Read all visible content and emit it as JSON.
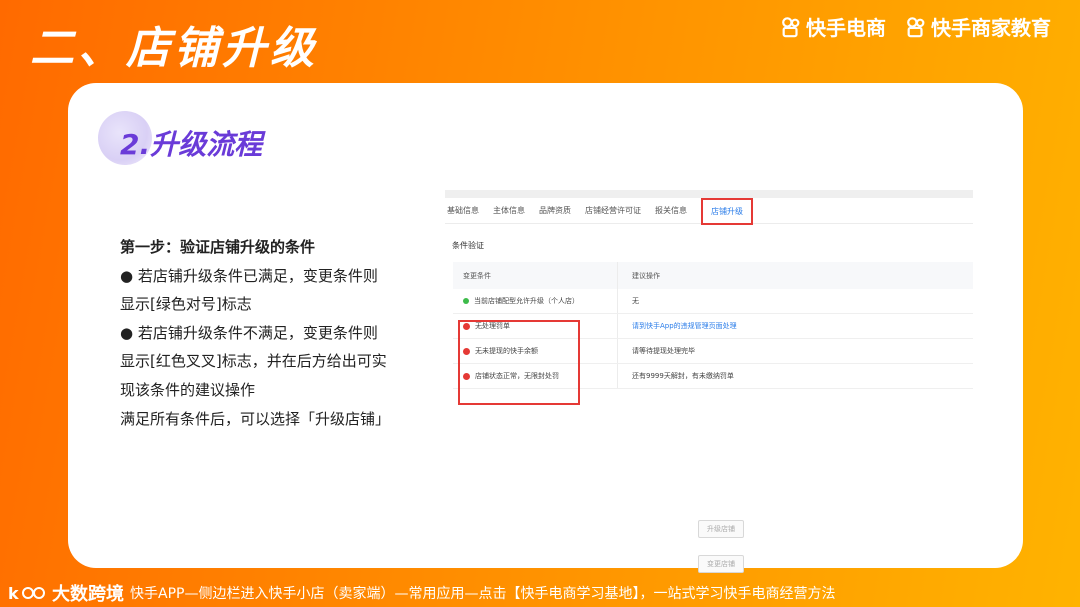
{
  "header": {
    "title": "二、店铺升级",
    "brand1": "快手电商",
    "brand2": "快手商家教育"
  },
  "section": {
    "subtitle": "2.升级流程"
  },
  "steps": {
    "lines": [
      "第一步：验证店铺升级的条件",
      "● 若店铺升级条件已满足，变更条件则",
      "显示[绿色对号]标志",
      "● 若店铺升级条件不满足，变更条件则",
      "显示[红色叉叉]标志，并在后方给出可实",
      "现该条件的建议操作",
      "满足所有条件后，可以选择「升级店铺」"
    ]
  },
  "screenshot": {
    "tabs": [
      "基础信息",
      "主体信息",
      "品牌资质",
      "店铺经营许可证",
      "报关信息",
      "店铺升级"
    ],
    "active_tab_index": 5,
    "section_title": "条件验证",
    "table_headers": [
      "变更条件",
      "建议操作"
    ],
    "rows": [
      {
        "status": "green",
        "condition": "当前店铺配型允许升级（个人店）",
        "suggestion": "无",
        "suggestion_is_link": false
      },
      {
        "status": "red",
        "condition": "无处理罚单",
        "suggestion": "请到快手App的违规管理页面处理",
        "suggestion_is_link": true
      },
      {
        "status": "red",
        "condition": "无未提现的快手余额",
        "suggestion": "请等待提现处理完毕",
        "suggestion_is_link": false
      },
      {
        "status": "red",
        "condition": "店铺状态正常，无限封处罚",
        "suggestion": "还有9999天解封，有未缴纳罚单",
        "suggestion_is_link": false
      }
    ],
    "buttons": [
      "升级店铺",
      "变更店铺"
    ],
    "colors": {
      "highlight": "#e53935",
      "link": "#2b7de9",
      "ok": "#3dbb4a"
    }
  },
  "footer": {
    "logo_text": "大数跨境",
    "note": "快手APP—侧边栏进入快手小店（卖家端）—常用应用—点击【快手电商学习基地】，一站式学习快手电商经营方法"
  }
}
